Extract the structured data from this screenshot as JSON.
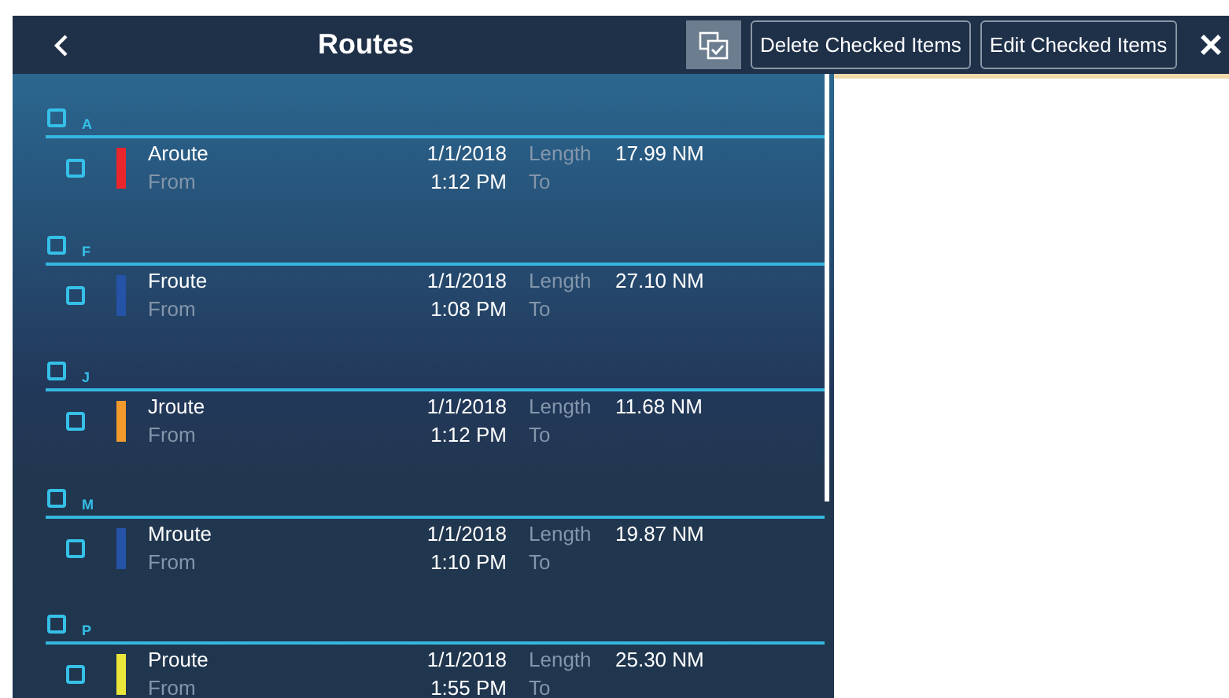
{
  "header": {
    "title": "Routes",
    "select_mode": {
      "selected": true
    },
    "buttons": [
      "Delete Checked Items",
      "Edit Checked Items"
    ]
  },
  "groups": [
    {
      "letter": "A",
      "checked": false,
      "routes": [
        {
          "name": "Aroute",
          "checked": false,
          "color": "#e8262b",
          "date": "1/1/2018",
          "time": "1:12 PM",
          "length_label": "Length",
          "length": "17.99 NM",
          "from_label": "From",
          "to_label": "To"
        }
      ]
    },
    {
      "letter": "F",
      "checked": false,
      "routes": [
        {
          "name": "Froute",
          "checked": false,
          "color": "#2453a8",
          "date": "1/1/2018",
          "time": "1:08 PM",
          "length_label": "Length",
          "length": "27.10 NM",
          "from_label": "From",
          "to_label": "To"
        }
      ]
    },
    {
      "letter": "J",
      "checked": false,
      "routes": [
        {
          "name": "Jroute",
          "checked": false,
          "color": "#f39a2c",
          "date": "1/1/2018",
          "time": "1:12 PM",
          "length_label": "Length",
          "length": "11.68 NM",
          "from_label": "From",
          "to_label": "To"
        }
      ]
    },
    {
      "letter": "M",
      "checked": false,
      "routes": [
        {
          "name": "Mroute",
          "checked": false,
          "color": "#2453a8",
          "date": "1/1/2018",
          "time": "1:10 PM",
          "length_label": "Length",
          "length": "19.87 NM",
          "from_label": "From",
          "to_label": "To"
        }
      ]
    },
    {
      "letter": "P",
      "checked": false,
      "routes": [
        {
          "name": "Proute",
          "checked": false,
          "color": "#ece53a",
          "date": "1/1/2018",
          "time": "1:55 PM",
          "length_label": "Length",
          "length": "25.30 NM",
          "from_label": "From",
          "to_label": "To"
        }
      ]
    }
  ]
}
